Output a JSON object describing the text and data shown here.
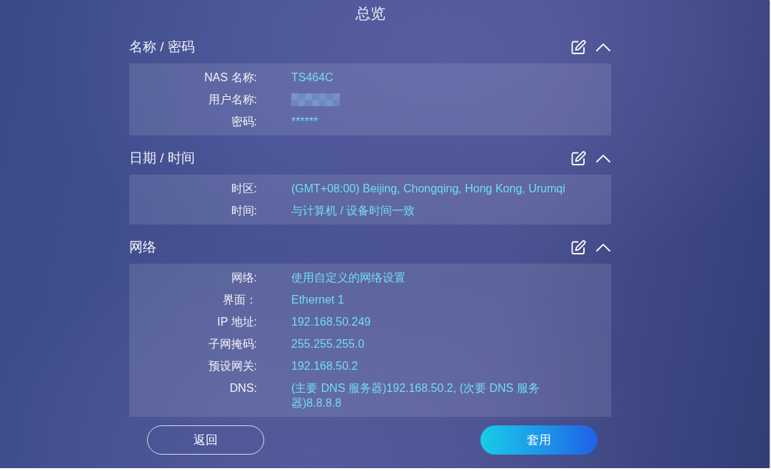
{
  "title": "总览",
  "sections": [
    {
      "heading": "名称 / 密码",
      "expanded": true,
      "rows": [
        {
          "label": "NAS 名称:",
          "kind": "text",
          "value": "TS464C"
        },
        {
          "label": "用户名称:",
          "kind": "blurred"
        },
        {
          "label": "密码:",
          "kind": "text",
          "value": "******"
        }
      ]
    },
    {
      "heading": "日期 / 时间",
      "expanded": true,
      "rows": [
        {
          "label": "时区:",
          "kind": "text",
          "value": "(GMT+08:00) Beijing, Chongqing, Hong Kong, Urumqi"
        },
        {
          "label": "时间:",
          "kind": "text",
          "value": "与计算机 / 设备时间一致"
        }
      ]
    },
    {
      "heading": "网络",
      "expanded": true,
      "rows": [
        {
          "label": "网络:",
          "kind": "text",
          "value": "使用自定义的网络设置"
        },
        {
          "label": "界面：",
          "kind": "text",
          "value": "Ethernet 1"
        },
        {
          "label": "IP 地址:",
          "kind": "text",
          "value": "192.168.50.249"
        },
        {
          "label": "子网掩码:",
          "kind": "text",
          "value": "255.255.255.0"
        },
        {
          "label": "预设网关:",
          "kind": "text",
          "value": "192.168.50.2"
        },
        {
          "label": "DNS:",
          "kind": "text",
          "value": "(主要 DNS 服务器)192.168.50.2, (次要 DNS 服务器)8.8.8.8"
        }
      ]
    }
  ],
  "buttons": [
    {
      "label": "返回",
      "kind": "secondary"
    },
    {
      "label": "套用",
      "kind": "primary"
    }
  ]
}
